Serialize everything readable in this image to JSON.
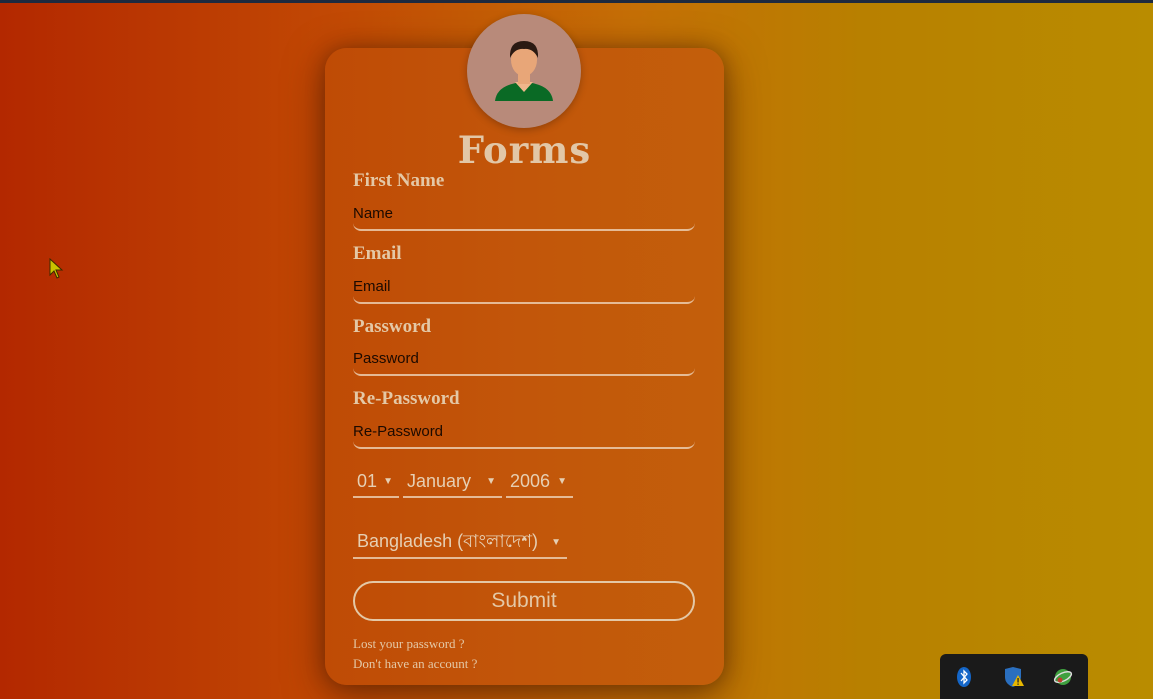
{
  "form": {
    "title": "Forms",
    "fields": [
      {
        "label": "First Name",
        "placeholder": "Name"
      },
      {
        "label": "Email",
        "placeholder": "Email"
      },
      {
        "label": "Password",
        "placeholder": "Password"
      },
      {
        "label": "Re-Password",
        "placeholder": "Re-Password"
      }
    ],
    "dob": {
      "day": "01",
      "month": "January",
      "year": "2006"
    },
    "country": "Bangladesh (বাংলাদেশ)",
    "submit_label": "Submit",
    "lost_password": "Lost your password ?",
    "no_account": "Don't have an account ?"
  },
  "colors": {
    "accent_text": "#e4c8a6",
    "card": "#c2560a"
  },
  "tray": {
    "icons": [
      "bluetooth-icon",
      "security-shield-warning-icon",
      "network-icon"
    ]
  }
}
